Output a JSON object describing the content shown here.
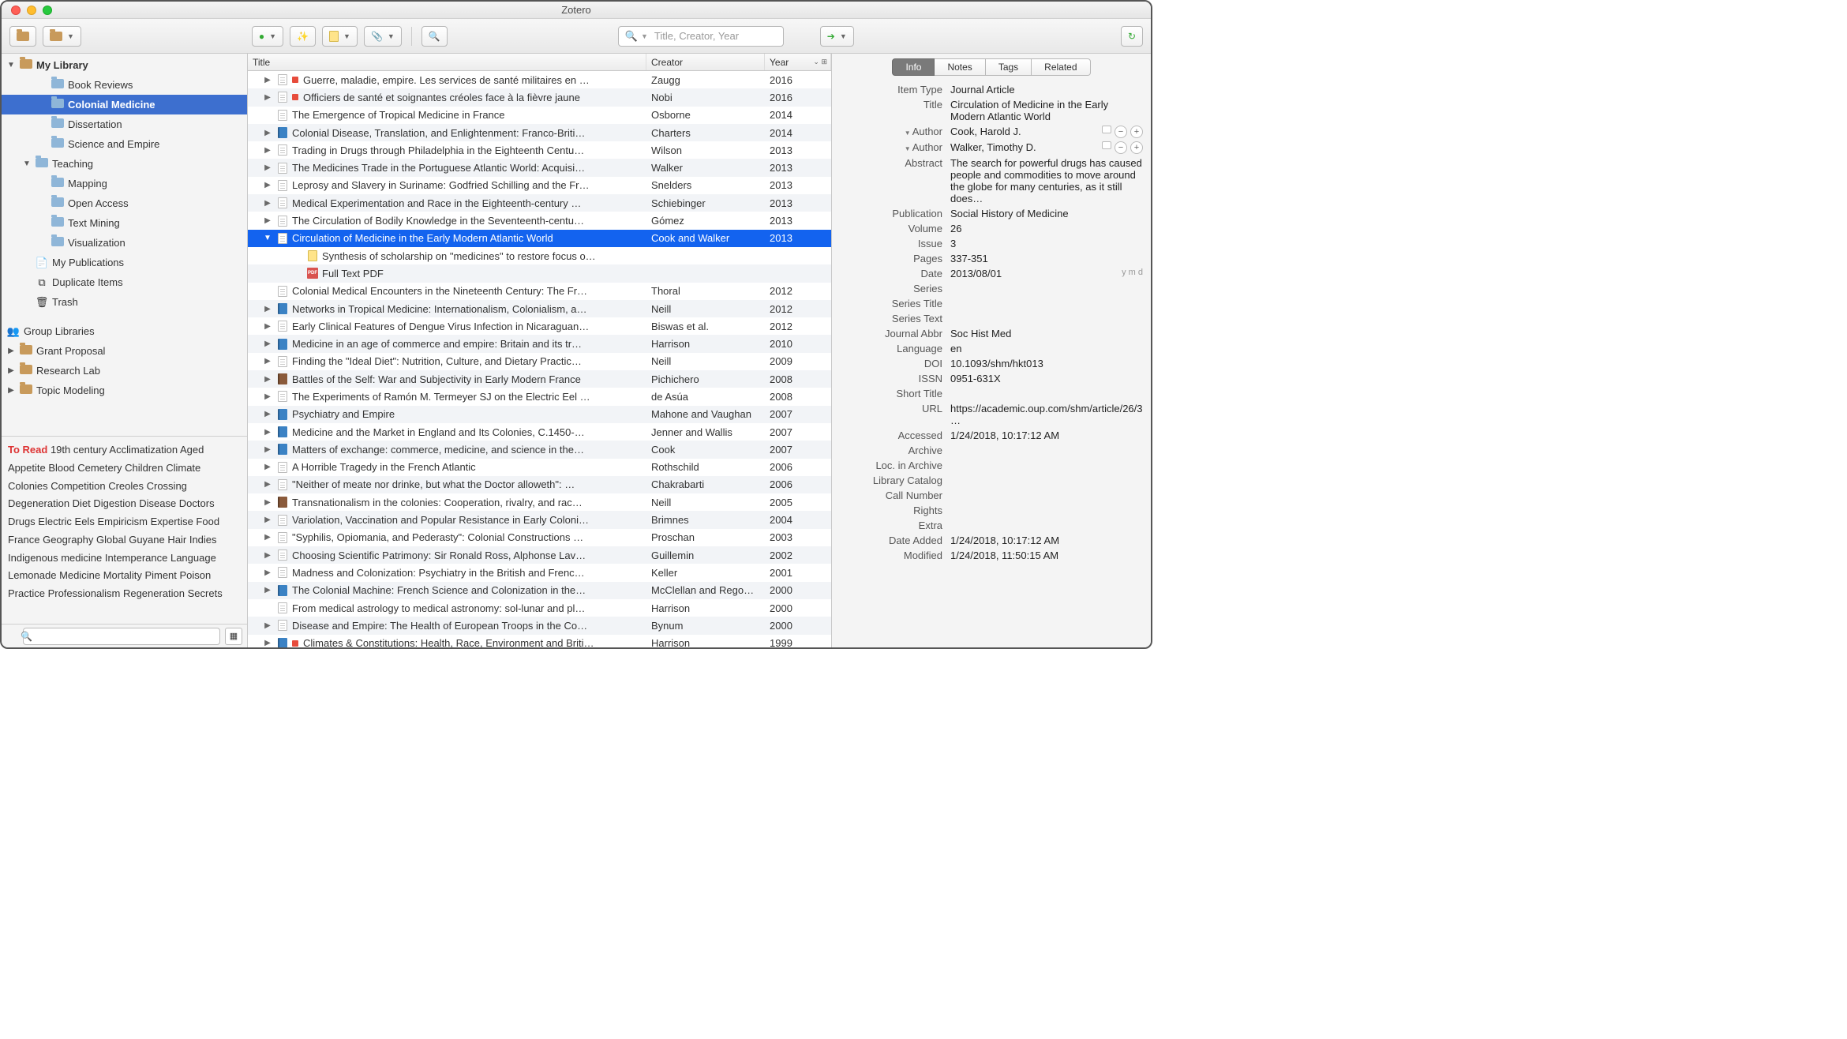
{
  "window": {
    "title": "Zotero"
  },
  "toolbar": {
    "search_placeholder": "Title, Creator, Year"
  },
  "sidebar": {
    "library": "My Library",
    "items": [
      {
        "label": "Book Reviews",
        "indent": 2,
        "icon": "folder"
      },
      {
        "label": "Colonial Medicine",
        "indent": 2,
        "icon": "folder",
        "selected": true,
        "bold": true
      },
      {
        "label": "Dissertation",
        "indent": 2,
        "icon": "folder"
      },
      {
        "label": "Science and Empire",
        "indent": 2,
        "icon": "folder"
      },
      {
        "label": "Teaching",
        "indent": 1,
        "icon": "folder",
        "arrow": "down"
      },
      {
        "label": "Mapping",
        "indent": 2,
        "icon": "folder"
      },
      {
        "label": "Open Access",
        "indent": 2,
        "icon": "folder"
      },
      {
        "label": "Text Mining",
        "indent": 2,
        "icon": "folder"
      },
      {
        "label": "Visualization",
        "indent": 2,
        "icon": "folder"
      },
      {
        "label": "My Publications",
        "indent": 1,
        "icon": "pub"
      },
      {
        "label": "Duplicate Items",
        "indent": 1,
        "icon": "dup"
      },
      {
        "label": "Trash",
        "indent": 1,
        "icon": "trash"
      }
    ],
    "group_header": "Group Libraries",
    "groups": [
      {
        "label": "Grant Proposal"
      },
      {
        "label": "Research Lab"
      },
      {
        "label": "Topic Modeling"
      }
    ]
  },
  "tags": {
    "to_read": "To Read",
    "list": [
      "19th century",
      "Acclimatization",
      "Aged",
      "Appetite",
      "Blood",
      "Cemetery",
      "Children",
      "Climate",
      "Colonies",
      "Competition",
      "Creoles",
      "Crossing",
      "Degeneration",
      "Diet",
      "Digestion",
      "Disease",
      "Doctors",
      "Drugs",
      "Electric Eels",
      "Empiricism",
      "Expertise",
      "Food",
      "France",
      "Geography",
      "Global",
      "Guyane",
      "Hair",
      "Indies",
      "Indigenous medicine",
      "Intemperance",
      "Language",
      "Lemonade",
      "Medicine",
      "Mortality",
      "Piment",
      "Poison",
      "Practice",
      "Professionalism",
      "Regeneration",
      "Secrets"
    ]
  },
  "columns": {
    "title": "Title",
    "creator": "Creator",
    "year": "Year"
  },
  "items": [
    {
      "arrow": "right",
      "icon": "doc",
      "tag": "red",
      "title": "Guerre, maladie, empire. Les services de santé militaires en …",
      "creator": "Zaugg",
      "year": "2016"
    },
    {
      "arrow": "right",
      "icon": "doc",
      "tag": "red",
      "title": "Officiers de santé et soignantes créoles face à la fièvre jaune",
      "creator": "Nobi",
      "year": "2016"
    },
    {
      "arrow": "",
      "icon": "doc",
      "title": "The Emergence of Tropical Medicine in France",
      "creator": "Osborne",
      "year": "2014"
    },
    {
      "arrow": "right",
      "icon": "book",
      "title": "Colonial Disease, Translation, and Enlightenment: Franco-Briti…",
      "creator": "Charters",
      "year": "2014"
    },
    {
      "arrow": "right",
      "icon": "doc",
      "title": "Trading in Drugs through Philadelphia in the Eighteenth Centu…",
      "creator": "Wilson",
      "year": "2013"
    },
    {
      "arrow": "right",
      "icon": "doc",
      "title": "The Medicines Trade in the Portuguese Atlantic World: Acquisi…",
      "creator": "Walker",
      "year": "2013"
    },
    {
      "arrow": "right",
      "icon": "doc",
      "title": "Leprosy and Slavery in Suriname: Godfried Schilling and the Fr…",
      "creator": "Snelders",
      "year": "2013"
    },
    {
      "arrow": "right",
      "icon": "doc",
      "title": "Medical Experimentation and Race in the Eighteenth-century …",
      "creator": "Schiebinger",
      "year": "2013"
    },
    {
      "arrow": "right",
      "icon": "doc",
      "title": "The Circulation of Bodily Knowledge in the Seventeenth-centu…",
      "creator": "Gómez",
      "year": "2013"
    },
    {
      "arrow": "down",
      "icon": "doc",
      "title": "Circulation of Medicine in the Early Modern Atlantic World",
      "creator": "Cook and Walker",
      "year": "2013",
      "selected": true
    },
    {
      "arrow": "child",
      "icon": "note",
      "title": "Synthesis of scholarship on \"medicines\" to restore focus o…",
      "creator": "",
      "year": ""
    },
    {
      "arrow": "child",
      "icon": "pdf",
      "title": "Full Text PDF",
      "creator": "",
      "year": ""
    },
    {
      "arrow": "",
      "icon": "doc",
      "title": "Colonial Medical Encounters in the Nineteenth Century: The Fr…",
      "creator": "Thoral",
      "year": "2012"
    },
    {
      "arrow": "right",
      "icon": "book",
      "title": "Networks in Tropical Medicine: Internationalism, Colonialism, a…",
      "creator": "Neill",
      "year": "2012"
    },
    {
      "arrow": "right",
      "icon": "doc",
      "title": "Early Clinical Features of Dengue Virus Infection in Nicaraguan…",
      "creator": "Biswas et al.",
      "year": "2012"
    },
    {
      "arrow": "right",
      "icon": "book",
      "title": "Medicine in an age of commerce and empire: Britain and its tr…",
      "creator": "Harrison",
      "year": "2010"
    },
    {
      "arrow": "right",
      "icon": "doc",
      "title": "Finding the \"Ideal Diet\": Nutrition, Culture, and Dietary Practic…",
      "creator": "Neill",
      "year": "2009"
    },
    {
      "arrow": "right",
      "icon": "bookbrown",
      "title": "Battles of the Self: War and Subjectivity in Early Modern France",
      "creator": "Pichichero",
      "year": "2008"
    },
    {
      "arrow": "right",
      "icon": "doc",
      "title": "The Experiments of Ramón M. Termeyer SJ on the Electric Eel …",
      "creator": "de Asúa",
      "year": "2008"
    },
    {
      "arrow": "right",
      "icon": "book",
      "title": "Psychiatry and Empire",
      "creator": "Mahone and Vaughan",
      "year": "2007"
    },
    {
      "arrow": "right",
      "icon": "book",
      "title": "Medicine and the Market in England and Its Colonies, C.1450-…",
      "creator": "Jenner and Wallis",
      "year": "2007"
    },
    {
      "arrow": "right",
      "icon": "book",
      "title": "Matters of exchange: commerce, medicine, and science in the…",
      "creator": "Cook",
      "year": "2007"
    },
    {
      "arrow": "right",
      "icon": "doc",
      "title": "A Horrible Tragedy in the French Atlantic",
      "creator": "Rothschild",
      "year": "2006"
    },
    {
      "arrow": "right",
      "icon": "doc",
      "title": "\"Neither of meate nor drinke, but what the Doctor alloweth\": …",
      "creator": "Chakrabarti",
      "year": "2006"
    },
    {
      "arrow": "right",
      "icon": "bookbrown",
      "title": "Transnationalism in the colonies: Cooperation, rivalry, and rac…",
      "creator": "Neill",
      "year": "2005"
    },
    {
      "arrow": "right",
      "icon": "doc",
      "title": "Variolation, Vaccination and Popular Resistance in Early Coloni…",
      "creator": "Brimnes",
      "year": "2004"
    },
    {
      "arrow": "right",
      "icon": "doc",
      "title": "\"Syphilis, Opiomania, and Pederasty\": Colonial Constructions …",
      "creator": "Proschan",
      "year": "2003"
    },
    {
      "arrow": "right",
      "icon": "doc",
      "title": "Choosing Scientific Patrimony: Sir Ronald Ross, Alphonse Lav…",
      "creator": "Guillemin",
      "year": "2002"
    },
    {
      "arrow": "right",
      "icon": "doc",
      "title": "Madness and Colonization: Psychiatry in the British and Frenc…",
      "creator": "Keller",
      "year": "2001"
    },
    {
      "arrow": "right",
      "icon": "book",
      "title": "The Colonial Machine: French Science and Colonization in the…",
      "creator": "McClellan and Rego…",
      "year": "2000"
    },
    {
      "arrow": "",
      "icon": "doc",
      "title": "From medical astrology to medical astronomy: sol-lunar and pl…",
      "creator": "Harrison",
      "year": "2000"
    },
    {
      "arrow": "right",
      "icon": "doc",
      "title": "Disease and Empire: The Health of European Troops in the Co…",
      "creator": "Bynum",
      "year": "2000"
    },
    {
      "arrow": "right",
      "icon": "book",
      "tag": "red",
      "title": "Climates & Constitutions: Health, Race, Environment and Briti…",
      "creator": "Harrison",
      "year": "1999"
    }
  ],
  "right_tabs": [
    "Info",
    "Notes",
    "Tags",
    "Related"
  ],
  "info": {
    "item_type_label": "Item Type",
    "item_type": "Journal Article",
    "title_label": "Title",
    "title": "Circulation of Medicine in the Early Modern Atlantic World",
    "author_label": "Author",
    "author1": "Cook, Harold J.",
    "author2": "Walker, Timothy D.",
    "abstract_label": "Abstract",
    "abstract": "The search for powerful drugs has caused people and commodities to move around the globe for many centuries, as it still does…",
    "publication_label": "Publication",
    "publication": "Social History of Medicine",
    "volume_label": "Volume",
    "volume": "26",
    "issue_label": "Issue",
    "issue": "3",
    "pages_label": "Pages",
    "pages": "337-351",
    "date_label": "Date",
    "date": "2013/08/01",
    "date_hint": "y m d",
    "series_label": "Series",
    "series_title_label": "Series Title",
    "series_text_label": "Series Text",
    "journal_abbr_label": "Journal Abbr",
    "journal_abbr": "Soc Hist Med",
    "language_label": "Language",
    "language": "en",
    "doi_label": "DOI",
    "doi": "10.1093/shm/hkt013",
    "issn_label": "ISSN",
    "issn": "0951-631X",
    "short_title_label": "Short Title",
    "url_label": "URL",
    "url": "https://academic.oup.com/shm/article/26/3…",
    "accessed_label": "Accessed",
    "accessed": "1/24/2018, 10:17:12 AM",
    "archive_label": "Archive",
    "loc_label": "Loc. in Archive",
    "catalog_label": "Library Catalog",
    "call_label": "Call Number",
    "rights_label": "Rights",
    "extra_label": "Extra",
    "added_label": "Date Added",
    "added": "1/24/2018, 10:17:12 AM",
    "modified_label": "Modified",
    "modified": "1/24/2018, 11:50:15 AM"
  }
}
